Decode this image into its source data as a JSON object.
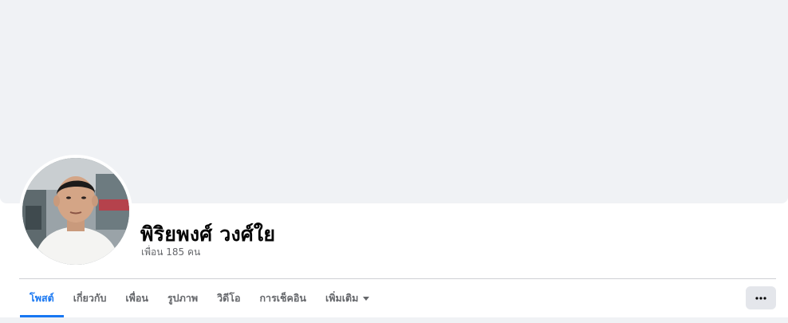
{
  "profile": {
    "name": "พิริยพงศ์ วงศ์ใย",
    "friends_count_label": "เพื่อน 185 คน"
  },
  "tabs": [
    {
      "label": "โพสต์",
      "active": true
    },
    {
      "label": "เกี่ยวกับ",
      "active": false
    },
    {
      "label": "เพื่อน",
      "active": false
    },
    {
      "label": "รูปภาพ",
      "active": false
    },
    {
      "label": "วิดีโอ",
      "active": false
    },
    {
      "label": "การเช็คอิน",
      "active": false
    },
    {
      "label": "เพิ่มเติม",
      "active": false,
      "has_dropdown": true
    }
  ],
  "actions": {
    "more_icon": "ellipsis-icon"
  },
  "colors": {
    "accent": "#1877f2",
    "cover_bg": "#f0f2f5",
    "muted_text": "#65676b"
  }
}
